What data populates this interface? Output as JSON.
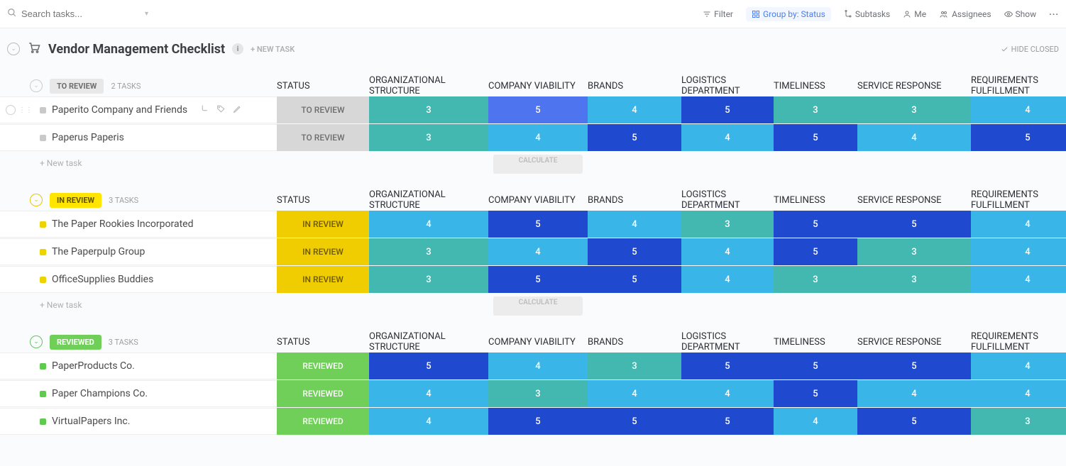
{
  "search": {
    "placeholder": "Search tasks..."
  },
  "toolbar": {
    "filter": "Filter",
    "group_by": "Group by: Status",
    "subtasks": "Subtasks",
    "me": "Me",
    "assignees": "Assignees",
    "show": "Show"
  },
  "header": {
    "title": "Vendor Management Checklist",
    "new_task": "+ NEW TASK",
    "hide_closed": "HIDE CLOSED"
  },
  "columns": {
    "status": "STATUS",
    "org": "ORGANIZATIONAL STRUCTURE",
    "viability": "COMPANY VIABILITY",
    "brands": "BRANDS",
    "logistics": "LOGISTICS DEPARTMENT",
    "timeliness": "TIMELINESS",
    "service": "SERVICE RESPONSE",
    "requirements": "REQUIREMENTS FULFILLMENT"
  },
  "footer": {
    "new_task": "+ New task",
    "calculate": "CALCULATE"
  },
  "groups": [
    {
      "id": "to_review",
      "label": "TO REVIEW",
      "count": "2 TASKS",
      "status_label": "TO REVIEW",
      "rows": [
        {
          "name": "Paperito Company and Friends",
          "org": "3",
          "viability": "5",
          "brands": "4",
          "logistics": "5",
          "timeliness": "3",
          "service": "3",
          "requirements": "4",
          "hovered": true,
          "cls": {
            "org": "s3",
            "viability": "sv",
            "brands": "s4",
            "logistics": "s5",
            "timeliness": "s3",
            "service": "s3",
            "requirements": "s4"
          }
        },
        {
          "name": "Paperus Paperis",
          "org": "3",
          "viability": "4",
          "brands": "5",
          "logistics": "4",
          "timeliness": "5",
          "service": "4",
          "requirements": "5",
          "cls": {
            "org": "s3",
            "viability": "s4",
            "brands": "s5",
            "logistics": "s4",
            "timeliness": "s5",
            "service": "s4",
            "requirements": "s5"
          }
        }
      ]
    },
    {
      "id": "in_review",
      "label": "IN REVIEW",
      "count": "3 TASKS",
      "status_label": "IN REVIEW",
      "rows": [
        {
          "name": "The Paper Rookies Incorporated",
          "org": "4",
          "viability": "5",
          "brands": "4",
          "logistics": "3",
          "timeliness": "5",
          "service": "5",
          "requirements": "4",
          "cls": {
            "org": "s4",
            "viability": "s5",
            "brands": "s4",
            "logistics": "s3",
            "timeliness": "s5",
            "service": "s5",
            "requirements": "s4"
          }
        },
        {
          "name": "The Paperpulp Group",
          "org": "3",
          "viability": "4",
          "brands": "5",
          "logistics": "4",
          "timeliness": "5",
          "service": "3",
          "requirements": "4",
          "cls": {
            "org": "s3",
            "viability": "s4",
            "brands": "s5",
            "logistics": "s4",
            "timeliness": "s5",
            "service": "s3",
            "requirements": "s4"
          }
        },
        {
          "name": "OfficeSupplies Buddies",
          "org": "3",
          "viability": "5",
          "brands": "5",
          "logistics": "4",
          "timeliness": "3",
          "service": "3",
          "requirements": "4",
          "cls": {
            "org": "s3",
            "viability": "s5",
            "brands": "s5",
            "logistics": "s4",
            "timeliness": "s3",
            "service": "s3",
            "requirements": "s4"
          }
        }
      ]
    },
    {
      "id": "reviewed",
      "label": "REVIEWED",
      "count": "3 TASKS",
      "status_label": "REVIEWED",
      "rows": [
        {
          "name": "PaperProducts Co.",
          "org": "5",
          "viability": "4",
          "brands": "3",
          "logistics": "5",
          "timeliness": "5",
          "service": "5",
          "requirements": "4",
          "cls": {
            "org": "s5",
            "viability": "s4",
            "brands": "s3",
            "logistics": "s5",
            "timeliness": "s5",
            "service": "s5",
            "requirements": "s4"
          }
        },
        {
          "name": "Paper Champions Co.",
          "org": "4",
          "viability": "3",
          "brands": "4",
          "logistics": "4",
          "timeliness": "5",
          "service": "4",
          "requirements": "4",
          "cls": {
            "org": "s4",
            "viability": "s3",
            "brands": "s4",
            "logistics": "s4",
            "timeliness": "s5",
            "service": "s4",
            "requirements": "s4"
          }
        },
        {
          "name": "VirtualPapers Inc.",
          "org": "4",
          "viability": "5",
          "brands": "5",
          "logistics": "5",
          "timeliness": "4",
          "service": "5",
          "requirements": "3",
          "cls": {
            "org": "s4",
            "viability": "s5",
            "brands": "s5",
            "logistics": "s5",
            "timeliness": "s4",
            "service": "s5",
            "requirements": "s3"
          }
        }
      ]
    }
  ]
}
